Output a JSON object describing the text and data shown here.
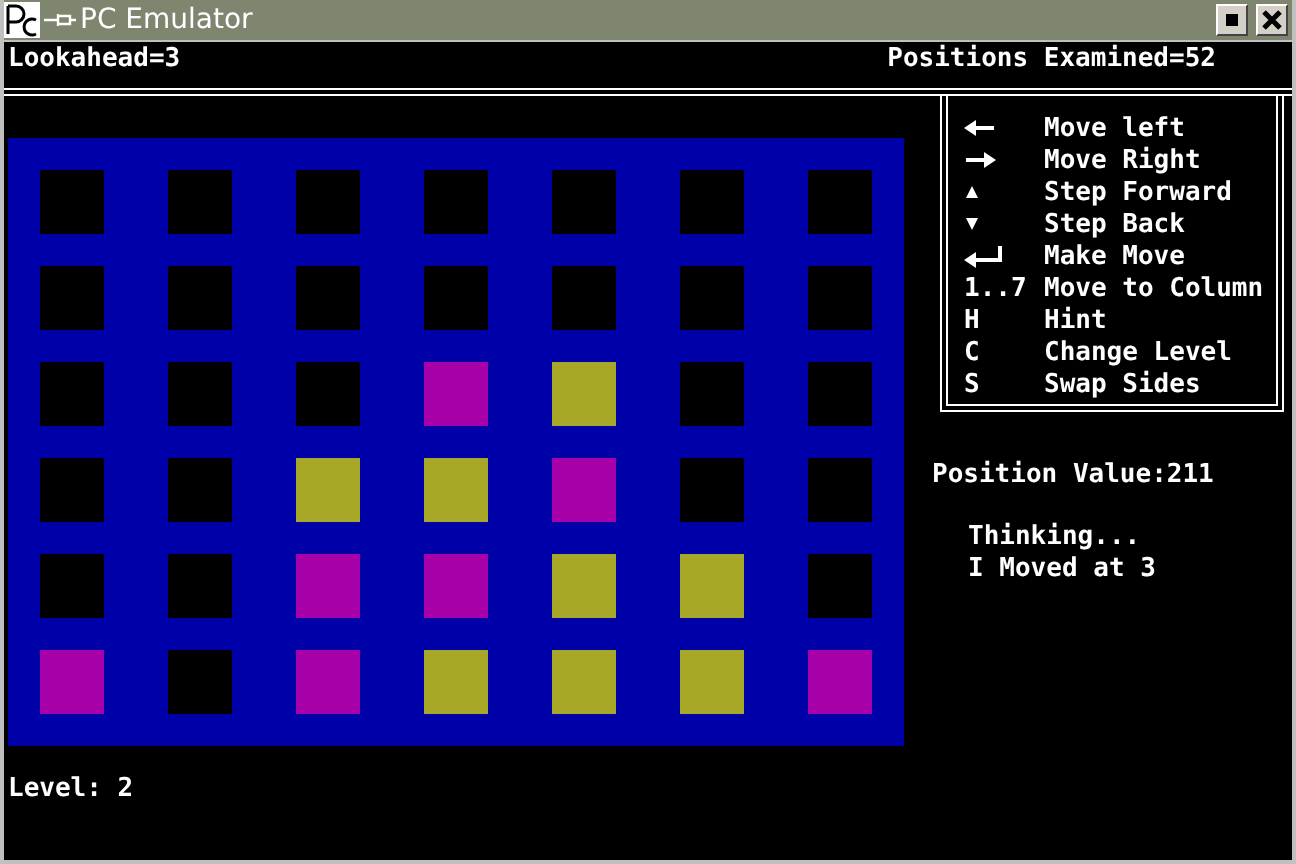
{
  "window": {
    "title": "PC Emulator"
  },
  "lookahead": "Lookahead=3",
  "positions_examined": "Positions Examined=52",
  "board": [
    {
      "cells": [
        {
          "color": "#000000"
        },
        {
          "color": "#000000"
        },
        {
          "color": "#000000"
        },
        {
          "color": "#000000"
        },
        {
          "color": "#000000"
        },
        {
          "color": "#000000"
        },
        {
          "color": "#000000"
        }
      ]
    },
    {
      "cells": [
        {
          "color": "#000000"
        },
        {
          "color": "#000000"
        },
        {
          "color": "#000000"
        },
        {
          "color": "#000000"
        },
        {
          "color": "#000000"
        },
        {
          "color": "#000000"
        },
        {
          "color": "#000000"
        }
      ]
    },
    {
      "cells": [
        {
          "color": "#000000"
        },
        {
          "color": "#000000"
        },
        {
          "color": "#000000"
        },
        {
          "color": "#a800a8"
        },
        {
          "color": "#a8a828"
        },
        {
          "color": "#000000"
        },
        {
          "color": "#000000"
        }
      ]
    },
    {
      "cells": [
        {
          "color": "#000000"
        },
        {
          "color": "#000000"
        },
        {
          "color": "#a8a828"
        },
        {
          "color": "#a8a828"
        },
        {
          "color": "#a800a8"
        },
        {
          "color": "#000000"
        },
        {
          "color": "#000000"
        }
      ]
    },
    {
      "cells": [
        {
          "color": "#000000"
        },
        {
          "color": "#000000"
        },
        {
          "color": "#a800a8"
        },
        {
          "color": "#a800a8"
        },
        {
          "color": "#a8a828"
        },
        {
          "color": "#a8a828"
        },
        {
          "color": "#000000"
        }
      ]
    },
    {
      "cells": [
        {
          "color": "#a800a8"
        },
        {
          "color": "#000000"
        },
        {
          "color": "#a800a8"
        },
        {
          "color": "#a8a828"
        },
        {
          "color": "#a8a828"
        },
        {
          "color": "#a8a828"
        },
        {
          "color": "#a800a8"
        }
      ]
    }
  ],
  "help": [
    {
      "kind": "left",
      "action": "Move left"
    },
    {
      "kind": "right",
      "action": "Move Right"
    },
    {
      "kind": "up",
      "action": "Step Forward"
    },
    {
      "kind": "down",
      "action": "Step Back"
    },
    {
      "kind": "enter",
      "action": "Make Move"
    },
    {
      "kind": "text",
      "key": "1..7",
      "action": "Move to Column"
    },
    {
      "kind": "text",
      "key": "H",
      "action": "Hint"
    },
    {
      "kind": "text",
      "key": "C",
      "action": "Change Level"
    },
    {
      "kind": "text",
      "key": "S",
      "action": "Swap Sides"
    }
  ],
  "position_value": "Position Value:211",
  "messages": [
    "Thinking...",
    "I Moved at 3"
  ],
  "level": "Level: 2"
}
